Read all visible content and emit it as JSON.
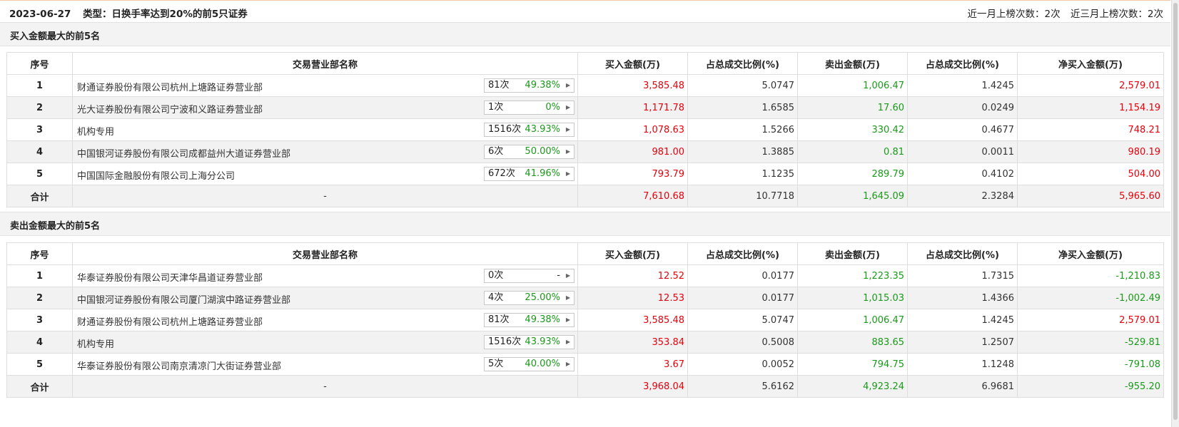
{
  "header": {
    "date": "2023-06-27",
    "type_text": "类型：日换手率达到20%的前5只证券",
    "month_count_text": "近一月上榜次数：2次",
    "quarter_count_text": "近三月上榜次数：2次"
  },
  "columns": [
    "序号",
    "交易营业部名称",
    "买入金额(万)",
    "占总成交比例(%)",
    "卖出金额(万)",
    "占总成交比例(%)",
    "净买入金额(万)"
  ],
  "buy_section": {
    "title": "买入金额最大的前5名",
    "rows": [
      {
        "idx": "1",
        "name": "财通证券股份有限公司杭州上塘路证券营业部",
        "count": "81次",
        "pct": "49.38%",
        "buy": "3,585.48",
        "buy_ratio": "5.0747",
        "sell": "1,006.47",
        "sell_ratio": "1.4245",
        "net": "2,579.01",
        "net_color": "red"
      },
      {
        "idx": "2",
        "name": "光大证券股份有限公司宁波和义路证券营业部",
        "count": "1次",
        "pct": "0%",
        "buy": "1,171.78",
        "buy_ratio": "1.6585",
        "sell": "17.60",
        "sell_ratio": "0.0249",
        "net": "1,154.19",
        "net_color": "red"
      },
      {
        "idx": "3",
        "name": "机构专用",
        "count": "1516次",
        "pct": "43.93%",
        "buy": "1,078.63",
        "buy_ratio": "1.5266",
        "sell": "330.42",
        "sell_ratio": "0.4677",
        "net": "748.21",
        "net_color": "red"
      },
      {
        "idx": "4",
        "name": "中国银河证券股份有限公司成都益州大道证券营业部",
        "count": "6次",
        "pct": "50.00%",
        "buy": "981.00",
        "buy_ratio": "1.3885",
        "sell": "0.81",
        "sell_ratio": "0.0011",
        "net": "980.19",
        "net_color": "red"
      },
      {
        "idx": "5",
        "name": "中国国际金融股份有限公司上海分公司",
        "count": "672次",
        "pct": "41.96%",
        "buy": "793.79",
        "buy_ratio": "1.1235",
        "sell": "289.79",
        "sell_ratio": "0.4102",
        "net": "504.00",
        "net_color": "red"
      }
    ],
    "total": {
      "label": "合计",
      "name": "-",
      "buy": "7,610.68",
      "buy_ratio": "10.7718",
      "sell": "1,645.09",
      "sell_ratio": "2.3284",
      "net": "5,965.60"
    }
  },
  "sell_section": {
    "title": "卖出金额最大的前5名",
    "rows": [
      {
        "idx": "1",
        "name": "华泰证券股份有限公司天津华昌道证券营业部",
        "count": "0次",
        "pct": "-",
        "buy": "12.52",
        "buy_ratio": "0.0177",
        "sell": "1,223.35",
        "sell_ratio": "1.7315",
        "net": "-1,210.83",
        "net_color": "green"
      },
      {
        "idx": "2",
        "name": "中国银河证券股份有限公司厦门湖滨中路证券营业部",
        "count": "4次",
        "pct": "25.00%",
        "buy": "12.53",
        "buy_ratio": "0.0177",
        "sell": "1,015.03",
        "sell_ratio": "1.4366",
        "net": "-1,002.49",
        "net_color": "green"
      },
      {
        "idx": "3",
        "name": "财通证券股份有限公司杭州上塘路证券营业部",
        "count": "81次",
        "pct": "49.38%",
        "buy": "3,585.48",
        "buy_ratio": "5.0747",
        "sell": "1,006.47",
        "sell_ratio": "1.4245",
        "net": "2,579.01",
        "net_color": "red"
      },
      {
        "idx": "4",
        "name": "机构专用",
        "count": "1516次",
        "pct": "43.93%",
        "buy": "353.84",
        "buy_ratio": "0.5008",
        "sell": "883.65",
        "sell_ratio": "1.2507",
        "net": "-529.81",
        "net_color": "green"
      },
      {
        "idx": "5",
        "name": "华泰证券股份有限公司南京清凉门大街证券营业部",
        "count": "5次",
        "pct": "40.00%",
        "buy": "3.67",
        "buy_ratio": "0.0052",
        "sell": "794.75",
        "sell_ratio": "1.1248",
        "net": "-791.08",
        "net_color": "green"
      }
    ],
    "total": {
      "label": "合计",
      "name": "-",
      "buy": "3,968.04",
      "buy_ratio": "5.6162",
      "sell": "4,923.24",
      "sell_ratio": "6.9681",
      "net": "-955.20"
    }
  },
  "colors": {
    "red": "#e8000b",
    "green": "#1a9a1a",
    "stripe": "#f2f2f2",
    "section_bg": "#f3f3f3"
  },
  "icons": {
    "tag_arrow": "triangle-right-icon"
  }
}
